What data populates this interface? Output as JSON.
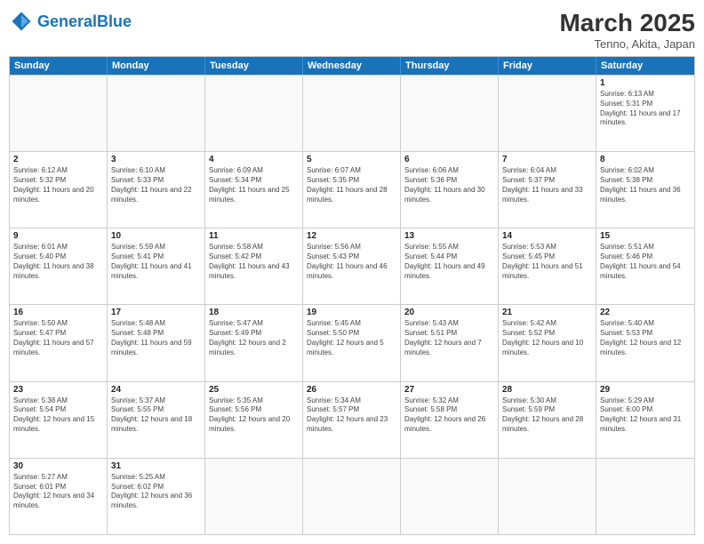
{
  "header": {
    "logo_general": "General",
    "logo_blue": "Blue",
    "month": "March 2025",
    "location": "Tenno, Akita, Japan"
  },
  "days_of_week": [
    "Sunday",
    "Monday",
    "Tuesday",
    "Wednesday",
    "Thursday",
    "Friday",
    "Saturday"
  ],
  "weeks": [
    [
      {
        "num": "",
        "info": ""
      },
      {
        "num": "",
        "info": ""
      },
      {
        "num": "",
        "info": ""
      },
      {
        "num": "",
        "info": ""
      },
      {
        "num": "",
        "info": ""
      },
      {
        "num": "",
        "info": ""
      },
      {
        "num": "1",
        "info": "Sunrise: 6:13 AM\nSunset: 5:31 PM\nDaylight: 11 hours and 17 minutes."
      }
    ],
    [
      {
        "num": "2",
        "info": "Sunrise: 6:12 AM\nSunset: 5:32 PM\nDaylight: 11 hours and 20 minutes."
      },
      {
        "num": "3",
        "info": "Sunrise: 6:10 AM\nSunset: 5:33 PM\nDaylight: 11 hours and 22 minutes."
      },
      {
        "num": "4",
        "info": "Sunrise: 6:09 AM\nSunset: 5:34 PM\nDaylight: 11 hours and 25 minutes."
      },
      {
        "num": "5",
        "info": "Sunrise: 6:07 AM\nSunset: 5:35 PM\nDaylight: 11 hours and 28 minutes."
      },
      {
        "num": "6",
        "info": "Sunrise: 6:06 AM\nSunset: 5:36 PM\nDaylight: 11 hours and 30 minutes."
      },
      {
        "num": "7",
        "info": "Sunrise: 6:04 AM\nSunset: 5:37 PM\nDaylight: 11 hours and 33 minutes."
      },
      {
        "num": "8",
        "info": "Sunrise: 6:02 AM\nSunset: 5:38 PM\nDaylight: 11 hours and 36 minutes."
      }
    ],
    [
      {
        "num": "9",
        "info": "Sunrise: 6:01 AM\nSunset: 5:40 PM\nDaylight: 11 hours and 38 minutes."
      },
      {
        "num": "10",
        "info": "Sunrise: 5:59 AM\nSunset: 5:41 PM\nDaylight: 11 hours and 41 minutes."
      },
      {
        "num": "11",
        "info": "Sunrise: 5:58 AM\nSunset: 5:42 PM\nDaylight: 11 hours and 43 minutes."
      },
      {
        "num": "12",
        "info": "Sunrise: 5:56 AM\nSunset: 5:43 PM\nDaylight: 11 hours and 46 minutes."
      },
      {
        "num": "13",
        "info": "Sunrise: 5:55 AM\nSunset: 5:44 PM\nDaylight: 11 hours and 49 minutes."
      },
      {
        "num": "14",
        "info": "Sunrise: 5:53 AM\nSunset: 5:45 PM\nDaylight: 11 hours and 51 minutes."
      },
      {
        "num": "15",
        "info": "Sunrise: 5:51 AM\nSunset: 5:46 PM\nDaylight: 11 hours and 54 minutes."
      }
    ],
    [
      {
        "num": "16",
        "info": "Sunrise: 5:50 AM\nSunset: 5:47 PM\nDaylight: 11 hours and 57 minutes."
      },
      {
        "num": "17",
        "info": "Sunrise: 5:48 AM\nSunset: 5:48 PM\nDaylight: 11 hours and 59 minutes."
      },
      {
        "num": "18",
        "info": "Sunrise: 5:47 AM\nSunset: 5:49 PM\nDaylight: 12 hours and 2 minutes."
      },
      {
        "num": "19",
        "info": "Sunrise: 5:45 AM\nSunset: 5:50 PM\nDaylight: 12 hours and 5 minutes."
      },
      {
        "num": "20",
        "info": "Sunrise: 5:43 AM\nSunset: 5:51 PM\nDaylight: 12 hours and 7 minutes."
      },
      {
        "num": "21",
        "info": "Sunrise: 5:42 AM\nSunset: 5:52 PM\nDaylight: 12 hours and 10 minutes."
      },
      {
        "num": "22",
        "info": "Sunrise: 5:40 AM\nSunset: 5:53 PM\nDaylight: 12 hours and 12 minutes."
      }
    ],
    [
      {
        "num": "23",
        "info": "Sunrise: 5:38 AM\nSunset: 5:54 PM\nDaylight: 12 hours and 15 minutes."
      },
      {
        "num": "24",
        "info": "Sunrise: 5:37 AM\nSunset: 5:55 PM\nDaylight: 12 hours and 18 minutes."
      },
      {
        "num": "25",
        "info": "Sunrise: 5:35 AM\nSunset: 5:56 PM\nDaylight: 12 hours and 20 minutes."
      },
      {
        "num": "26",
        "info": "Sunrise: 5:34 AM\nSunset: 5:57 PM\nDaylight: 12 hours and 23 minutes."
      },
      {
        "num": "27",
        "info": "Sunrise: 5:32 AM\nSunset: 5:58 PM\nDaylight: 12 hours and 26 minutes."
      },
      {
        "num": "28",
        "info": "Sunrise: 5:30 AM\nSunset: 5:59 PM\nDaylight: 12 hours and 28 minutes."
      },
      {
        "num": "29",
        "info": "Sunrise: 5:29 AM\nSunset: 6:00 PM\nDaylight: 12 hours and 31 minutes."
      }
    ],
    [
      {
        "num": "30",
        "info": "Sunrise: 5:27 AM\nSunset: 6:01 PM\nDaylight: 12 hours and 34 minutes."
      },
      {
        "num": "31",
        "info": "Sunrise: 5:25 AM\nSunset: 6:02 PM\nDaylight: 12 hours and 36 minutes."
      },
      {
        "num": "",
        "info": ""
      },
      {
        "num": "",
        "info": ""
      },
      {
        "num": "",
        "info": ""
      },
      {
        "num": "",
        "info": ""
      },
      {
        "num": "",
        "info": ""
      }
    ]
  ]
}
